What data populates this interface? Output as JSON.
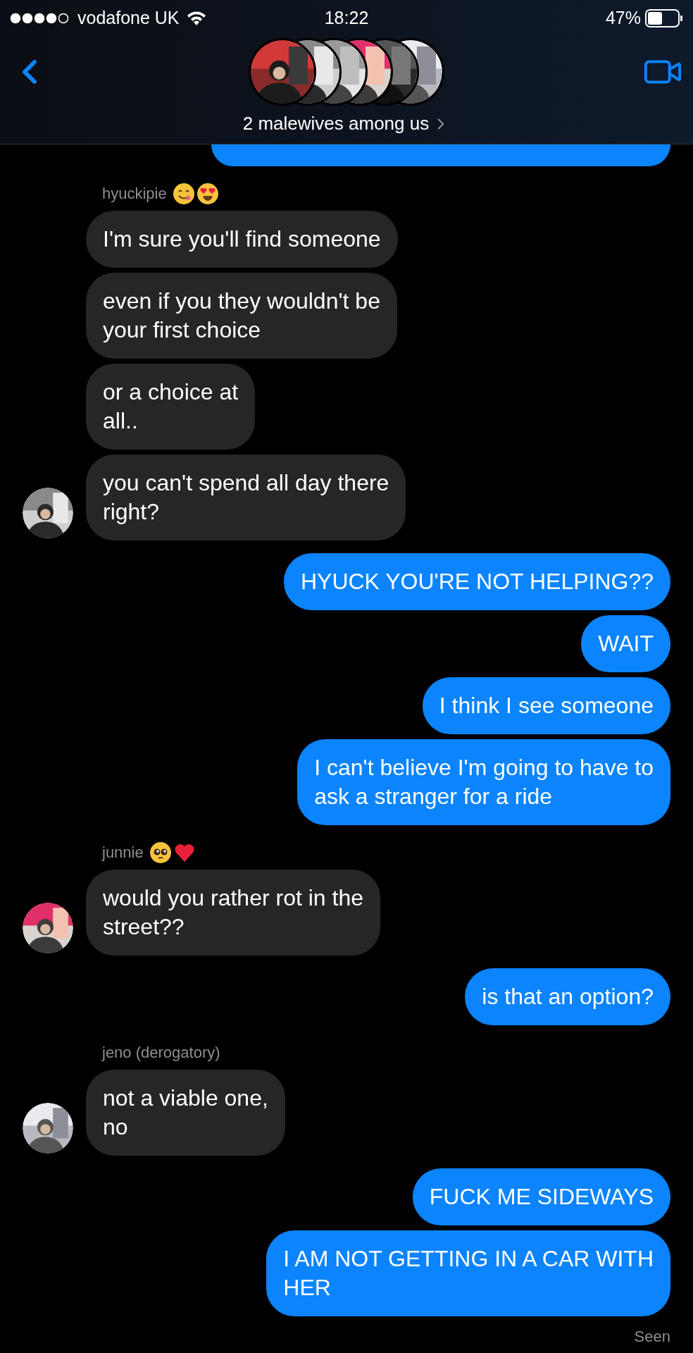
{
  "status_bar": {
    "carrier": "vodafone UK",
    "time": "18:22",
    "battery": "47%"
  },
  "header": {
    "title": "2 malewives among us"
  },
  "groups": [
    {
      "kind": "sent-partial"
    },
    {
      "kind": "received",
      "avatar": true,
      "sender": {
        "name": "hyuckipie",
        "emojis": [
          {
            "kind": "yum"
          },
          {
            "kind": "heart-eyes"
          }
        ]
      },
      "bubbles": [
        {
          "text": "I'm sure you'll find someone"
        },
        {
          "text": "even if you they wouldn't be\nyour first choice"
        },
        {
          "text": "or a choice at\nall.."
        },
        {
          "text": "you can't spend all day there\nright?"
        }
      ]
    },
    {
      "kind": "sent",
      "bubbles": [
        {
          "text": "HYUCK YOU'RE NOT HELPING??"
        },
        {
          "text": "WAIT"
        },
        {
          "text": "I think I see someone"
        },
        {
          "text": "I can't believe I'm going to have to\nask a stranger for a ride"
        }
      ]
    },
    {
      "kind": "received",
      "avatar": true,
      "sender": {
        "name": "junnie",
        "emojis": [
          {
            "kind": "pleading"
          },
          {
            "kind": "heart"
          }
        ]
      },
      "bubbles": [
        {
          "text": "would you rather rot in the\nstreet??"
        }
      ]
    },
    {
      "kind": "sent",
      "bubbles": [
        {
          "text": "is that an option?"
        }
      ]
    },
    {
      "kind": "received",
      "avatar": true,
      "sender": {
        "name": "jeno (derogatory)"
      },
      "bubbles": [
        {
          "text": "not a viable one,\nno"
        }
      ]
    },
    {
      "kind": "sent",
      "bubbles": [
        {
          "text": "FUCK ME SIDEWAYS"
        },
        {
          "text": "I AM NOT GETTING IN A CAR WITH\nHER"
        }
      ]
    }
  ],
  "receipt": "Seen"
}
